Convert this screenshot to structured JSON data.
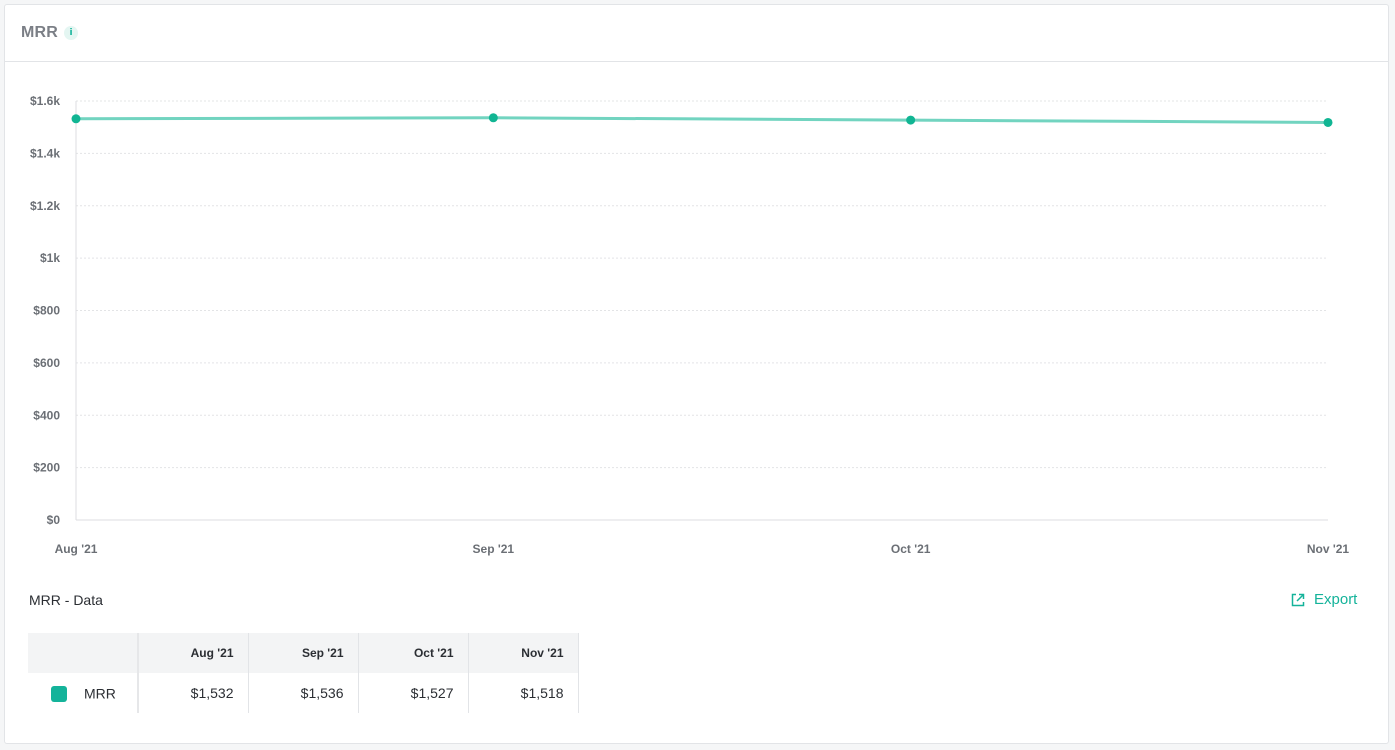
{
  "header": {
    "title": "MRR",
    "info_icon": "i"
  },
  "colors": {
    "accent": "#14b39a",
    "line": "#72d4c0",
    "point": "#11b593"
  },
  "chart_data": {
    "type": "line",
    "categories": [
      "Aug '21",
      "Sep '21",
      "Oct '21",
      "Nov '21"
    ],
    "series": [
      {
        "name": "MRR",
        "values": [
          1532,
          1536,
          1527,
          1518
        ]
      }
    ],
    "ylim": [
      0,
      1600
    ],
    "yticks": [
      0,
      200,
      400,
      600,
      800,
      1000,
      1200,
      1400,
      1600
    ],
    "ytick_labels": [
      "$0",
      "$200",
      "$400",
      "$600",
      "$800",
      "$1k",
      "$1.2k",
      "$1.4k",
      "$1.6k"
    ],
    "grid": true,
    "title": "",
    "xlabel": "",
    "ylabel": ""
  },
  "data_section": {
    "title": "MRR - Data",
    "export_label": "Export",
    "columns": [
      "Aug '21",
      "Sep '21",
      "Oct '21",
      "Nov '21"
    ],
    "rows": [
      {
        "series": "MRR",
        "values": [
          "$1,532",
          "$1,536",
          "$1,527",
          "$1,518"
        ]
      }
    ]
  }
}
